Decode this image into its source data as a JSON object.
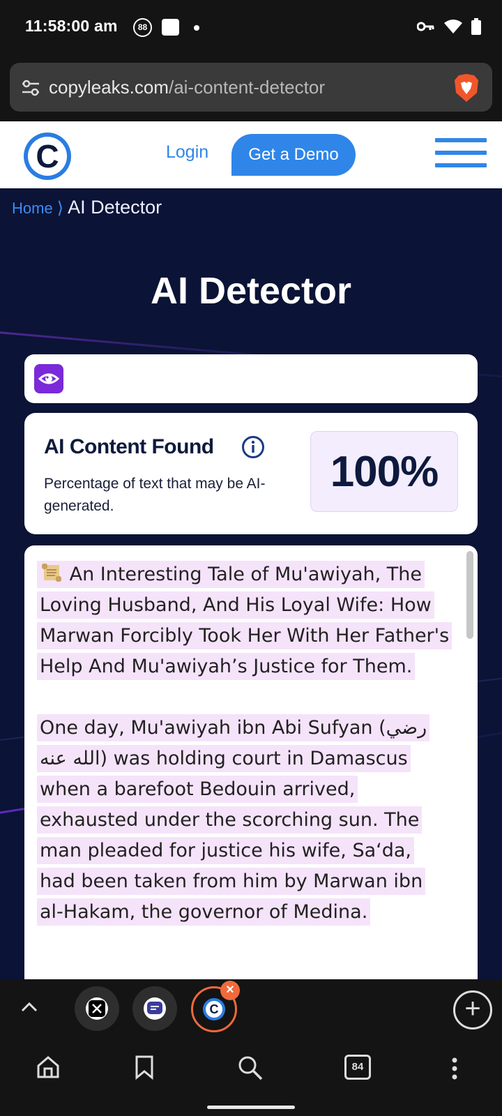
{
  "status_bar": {
    "time": "11:58:00 am",
    "badge": "88"
  },
  "browser": {
    "url_domain": "copyleaks.com",
    "url_path": "/ai-content-detector",
    "tune_icon": "tune-icon",
    "brave_icon": "brave-lion-icon"
  },
  "header": {
    "logo_letter": "C",
    "login": "Login",
    "demo": "Get a Demo"
  },
  "breadcrumb": {
    "home": "Home",
    "separator": "⟩",
    "current": "AI Detector"
  },
  "page_title": "AI Detector",
  "result": {
    "title": "AI Content Found",
    "description": "Percentage of text that may be AI-generated.",
    "score": "100%"
  },
  "text": {
    "heading": "An Interesting Tale of Mu'awiyah, The Loving Husband, And His Loyal Wife: How Marwan Forcibly Took Her With Her Father's Help And Mu'awiyah’s Justice for Them.",
    "paragraph_1": "One day, Mu'awiyah ibn Abi Sufyan (رضي الله عنه) was holding court in Damascus when a barefoot Bedouin arrived, exhausted under the scorching sun. The man pleaded for justice his wife, Sa‘da, had been taken from him by Marwan ibn al-Hakam, the governor of Medina."
  },
  "tabs": {
    "close": "×",
    "add": "+",
    "chip_colors": [
      "#ffffff",
      "#ffffff",
      "#2a7de1"
    ]
  },
  "bottom_nav": {
    "tab_count": "84"
  },
  "colors": {
    "accent": "#2f86e8",
    "purple": "#7a2ad8",
    "highlight": "#f5e3fa",
    "page_bg": "#0b1336"
  }
}
